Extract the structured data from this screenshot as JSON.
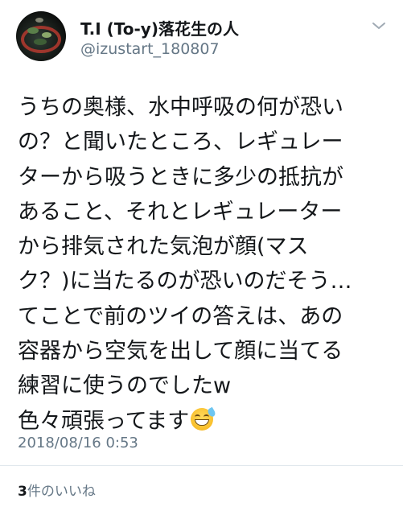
{
  "user": {
    "display_name": "T.I (To-y)落花生の人",
    "handle": "@izustart_180807",
    "avatar_icon": "profile-photo"
  },
  "menu_icon": "chevron-down-icon",
  "tweet": {
    "lines": [
      "うちの奥様、水中呼吸の何が恐い",
      "の？と聞いたところ、レギュレー",
      "ターから吸うときに多少の抵抗が",
      "あること、それとレギュレーター",
      "から排気された気泡が顔(マス",
      "ク？)に当たるのが恐いのだそう…",
      "てことで前のツイの答えは、あの",
      "容器から空気を出して顔に当てる",
      "練習に使うのでしたw",
      "色々頑張ってます"
    ],
    "emoji": "grinning-face-with-sweat"
  },
  "timestamp": "2018/08/16 0:53",
  "likes": {
    "count": "3",
    "label": "件のいいね"
  }
}
